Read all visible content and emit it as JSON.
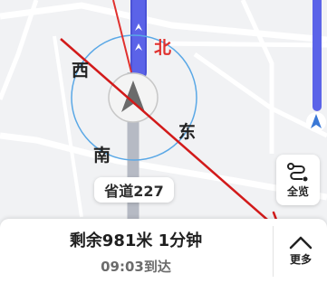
{
  "map": {
    "compass": {
      "north": "北",
      "west": "西",
      "east": "东",
      "south": "南"
    },
    "road_label": "省道227"
  },
  "side_buttons": {
    "overview_label": "全览"
  },
  "bottom_panel": {
    "remaining": "剩余981米 1分钟",
    "eta": "09:03到达",
    "more_label": "更多"
  },
  "colors": {
    "route": "#5b63e8",
    "traveled": "#b6bac4",
    "compass_ring": "#5aa8e6",
    "north": "#e0312e",
    "annotation_arrow": "#d21a1a"
  }
}
